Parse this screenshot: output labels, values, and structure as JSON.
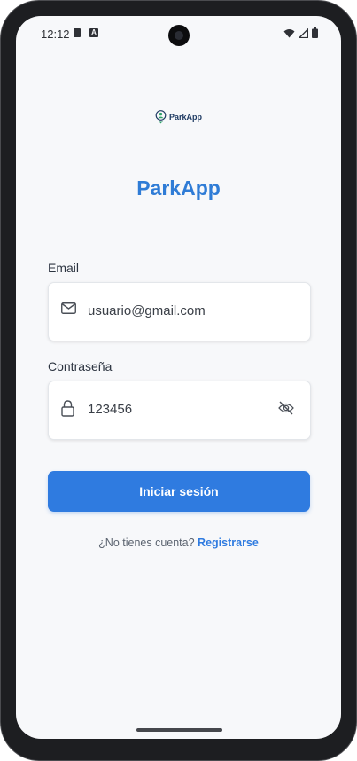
{
  "status_bar": {
    "time": "12:12",
    "icons": [
      "sd-card-icon",
      "font-a-icon",
      "wifi-icon",
      "signal-icon",
      "battery-icon"
    ]
  },
  "logo": {
    "text": "ParkApp",
    "icon": "parking-pin-icon"
  },
  "app_title": "ParkApp",
  "form": {
    "email_label": "Email",
    "email_value": "usuario@gmail.com",
    "password_label": "Contraseña",
    "password_value": "123456",
    "submit_label": "Iniciar sesión"
  },
  "footer": {
    "prompt": "¿No tienes cuenta?",
    "link": "Registrarse"
  },
  "colors": {
    "accent": "#2f7be0",
    "title": "#2f7cd6",
    "background": "#f7f8fa"
  }
}
